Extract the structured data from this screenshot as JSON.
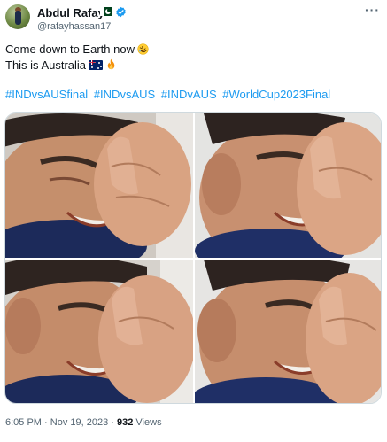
{
  "user": {
    "name": "Abdul Rafay",
    "handle": "@rafayhassan17",
    "flag_icon": "pakistan-flag-icon",
    "verified_icon": "verified-badge-icon",
    "verified_color": "#1d9bf0"
  },
  "menu": {
    "more_label": "···"
  },
  "tweet": {
    "line1": "Come down to Earth now",
    "line1_emoji": "rolling-on-floor-laughing-icon",
    "line2": "This is Australia",
    "line2_emojis": [
      "australia-flag-icon",
      "fire-icon"
    ],
    "hashtags": [
      "#INDvsAUSfinal",
      "#INDvsAUS",
      "#INDvAUS",
      "#WorldCup2023Final"
    ],
    "hashtag_color": "#1d9bf0"
  },
  "media": {
    "image_count": 4
  },
  "meta": {
    "time": "6:05 PM",
    "separator": "·",
    "date": "Nov 19, 2023",
    "views_count": "932",
    "views_label": "Views"
  },
  "colors": {
    "text": "#0f1419",
    "secondary": "#536471",
    "border": "#cfd9de"
  }
}
